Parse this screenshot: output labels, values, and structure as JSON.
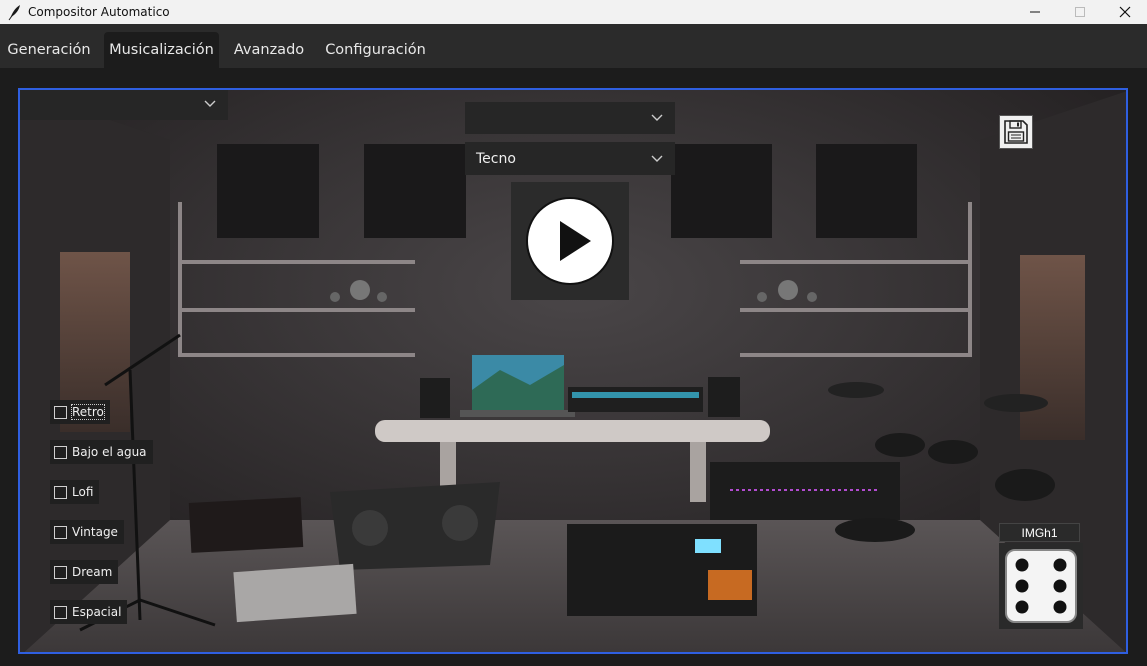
{
  "window": {
    "title": "Compositor Automatico",
    "controls": [
      "minimize-icon",
      "maximize-icon",
      "close-icon"
    ]
  },
  "tabs": [
    {
      "label": "Generación",
      "active": false
    },
    {
      "label": "Musicalización",
      "active": true
    },
    {
      "label": "Avanzado",
      "active": false
    },
    {
      "label": "Configuración",
      "active": false
    }
  ],
  "scene": {
    "top_left_dropdown": {
      "value": ""
    },
    "top_dropdown": {
      "value": ""
    },
    "genre_dropdown": {
      "value": "Tecno"
    },
    "play_button": {
      "icon": "play-icon"
    },
    "save_button": {
      "icon": "floppy-disk-icon"
    },
    "effects": [
      {
        "label": "Retro",
        "checked": false
      },
      {
        "label": "Bajo el agua",
        "checked": false
      },
      {
        "label": "Lofi",
        "checked": false
      },
      {
        "label": "Vintage",
        "checked": false
      },
      {
        "label": "Dream",
        "checked": false
      },
      {
        "label": "Espacial",
        "checked": false
      }
    ],
    "image_label": "IMGh1",
    "dice_button": {
      "icon": "dice-six-icon"
    }
  },
  "colors": {
    "accent_border": "#2f5fe0",
    "tab_bar": "#2b2b2b",
    "background": "#1c1c1c"
  }
}
